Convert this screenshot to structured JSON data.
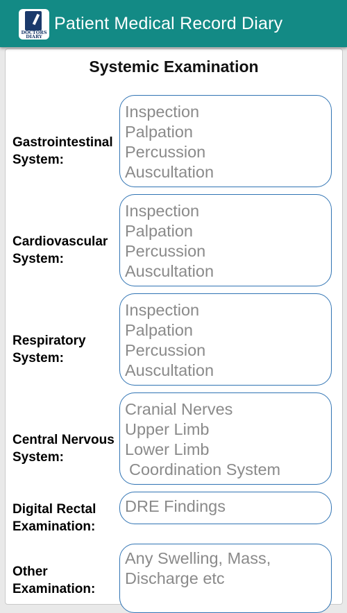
{
  "app": {
    "title": "Patient Medical Record Diary",
    "icon_text_line1": "DOCTORS",
    "icon_text_line2": "DIARY",
    "header_color": "#138a85"
  },
  "section": {
    "title": "Systemic Examination"
  },
  "fields": {
    "gastrointestinal": {
      "label_line1": "Gastrointestinal",
      "label_line2": "System:",
      "placeholder": [
        "Inspection",
        "Palpation",
        "Percussion",
        "Auscultation"
      ]
    },
    "cardiovascular": {
      "label_line1": "Cardiovascular",
      "label_line2": "System:",
      "placeholder": [
        "Inspection",
        "Palpation",
        "Percussion",
        "Auscultation"
      ]
    },
    "respiratory": {
      "label_line1": "Respiratory",
      "label_line2": "System:",
      "placeholder": [
        "Inspection",
        "Palpation",
        "Percussion",
        "Auscultation"
      ]
    },
    "cns": {
      "label_line1": "Central Nervous",
      "label_line2": "System:",
      "placeholder": [
        "Cranial Nerves",
        "Upper Limb",
        "Lower Limb",
        "Coordination System"
      ]
    },
    "dre": {
      "label_line1": "Digital Rectal",
      "label_line2": "Examination:",
      "placeholder": [
        "DRE Findings"
      ]
    },
    "other": {
      "label_line1": "Other",
      "label_line2": "Examination:",
      "placeholder": [
        "Any Swelling, Mass,",
        "Discharge etc"
      ]
    }
  }
}
